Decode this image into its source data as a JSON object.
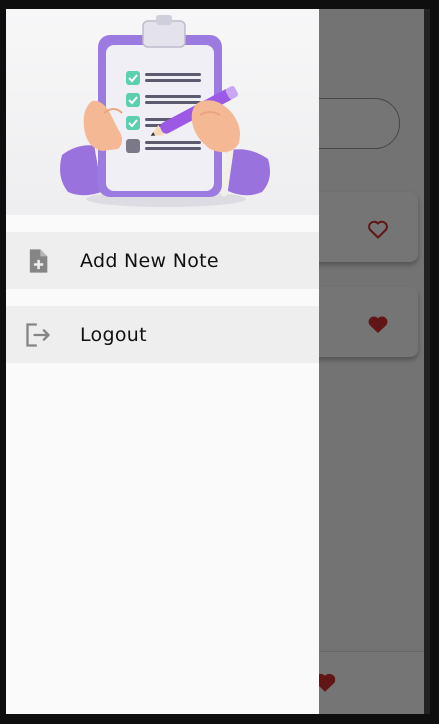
{
  "drawer": {
    "header_image": "clipboard-checklist-illustration",
    "items": [
      {
        "label": "Add New Note",
        "icon": "note-add-icon"
      },
      {
        "label": "Logout",
        "icon": "logout-icon"
      }
    ]
  },
  "background_app": {
    "cards": [
      {
        "favorite": false
      },
      {
        "favorite": true
      }
    ],
    "bottom_bar": {
      "favorite_icon": "heart-icon"
    }
  },
  "colors": {
    "heart": "#d32f2f",
    "drawer_bg": "#fafafa",
    "menu_item_bg": "#eeeeee",
    "clipboard": "#9b7be0",
    "check": "#5ccfb1"
  }
}
